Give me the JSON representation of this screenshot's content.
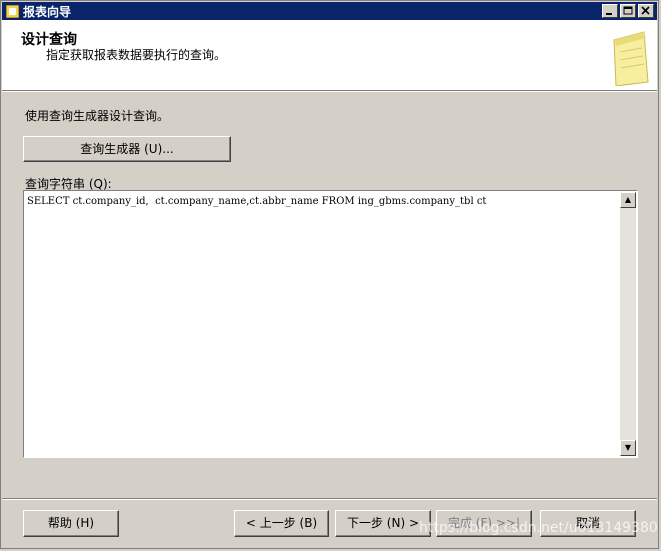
{
  "window": {
    "title": "报表向导"
  },
  "header": {
    "title": "设计查询",
    "subtitle": "指定获取报表数据要执行的查询。"
  },
  "main": {
    "instruction": "使用查询生成器设计查询。",
    "query_builder_label": "查询生成器 (U)...",
    "query_string_label": "查询字符串 (Q):",
    "query_text": "SELECT ct.company_id,  ct.company_name,ct.abbr_name FROM ing_gbms.company_tbl ct"
  },
  "footer": {
    "help_label": "帮助 (H)",
    "back_label": "< 上一步 (B)",
    "next_label": "下一步 (N) >",
    "finish_label": "完成 (F) >>|",
    "cancel_label": "取消"
  },
  "watermark": "https://blog.csdn.net/u013149380"
}
